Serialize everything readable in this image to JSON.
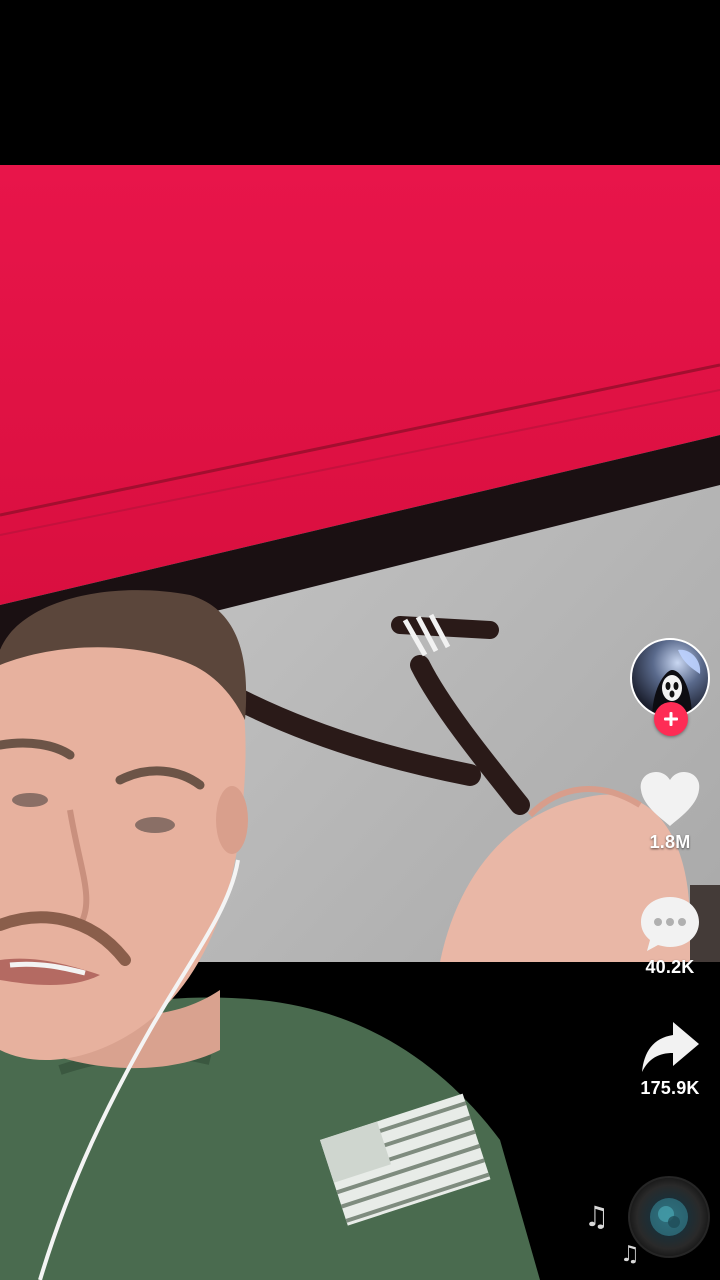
{
  "actions": {
    "likes": "1.8M",
    "comments": "40.2K",
    "shares": "175.9K"
  },
  "icons": {
    "follow": "plus-icon",
    "like": "heart-icon",
    "comment": "comment-bubble-icon",
    "share": "share-arrow-icon",
    "sound": "music-note-icon"
  },
  "colors": {
    "accent": "#fe2c55"
  }
}
